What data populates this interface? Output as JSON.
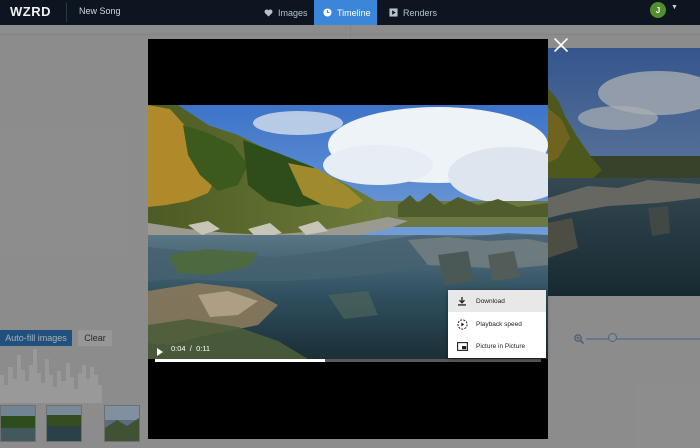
{
  "app": {
    "logo": "WZRD",
    "project_name": "New Song",
    "user_initial": "J"
  },
  "nav": {
    "tabs": [
      {
        "label": "Images",
        "icon": "heart-icon",
        "active": false
      },
      {
        "label": "Timeline",
        "icon": "clock-icon",
        "active": true
      },
      {
        "label": "Renders",
        "icon": "film-icon",
        "active": false
      }
    ],
    "accent": "#3b86d8"
  },
  "background": {
    "autofill_label": "Auto-fill images",
    "clear_label": "Clear"
  },
  "player": {
    "current_time": "0:04",
    "duration": "0:11",
    "progress_fraction": 0.44
  },
  "context_menu": {
    "items": [
      {
        "label": "Download",
        "icon": "download-icon"
      },
      {
        "label": "Playback speed",
        "icon": "playback-speed-icon"
      },
      {
        "label": "Picture in Picture",
        "icon": "picture-in-picture-icon"
      }
    ]
  }
}
